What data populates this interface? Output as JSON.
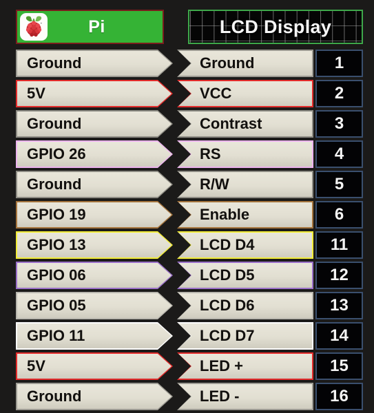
{
  "header": {
    "left": {
      "label": "Pi",
      "icon": "raspberry-pi-logo",
      "bg_color": "#35b335",
      "border_color": "#7a1d1d"
    },
    "right": {
      "label": "LCD Display",
      "bg_color": "#050505",
      "border_color": "#3ea84a"
    }
  },
  "rows": [
    {
      "pi": "Ground",
      "lcd": "Ground",
      "pin": "1",
      "color": "#9c9a92"
    },
    {
      "pi": "5V",
      "lcd": "VCC",
      "pin": "2",
      "color": "#e32b2b"
    },
    {
      "pi": "Ground",
      "lcd": "Contrast",
      "pin": "3",
      "color": "#8d8b83"
    },
    {
      "pi": "GPIO 26",
      "lcd": "RS",
      "pin": "4",
      "color": "#edb3ef"
    },
    {
      "pi": "Ground",
      "lcd": "R/W",
      "pin": "5",
      "color": "#8d8b83"
    },
    {
      "pi": "GPIO 19",
      "lcd": "Enable",
      "pin": "6",
      "color": "#a5743c"
    },
    {
      "pi": "GPIO 13",
      "lcd": "LCD D4",
      "pin": "11",
      "color": "#f2ec36"
    },
    {
      "pi": "GPIO 06",
      "lcd": "LCD D5",
      "pin": "12",
      "color": "#9a6fc9"
    },
    {
      "pi": "GPIO 05",
      "lcd": "LCD D6",
      "pin": "13",
      "color": "#b8b6ae"
    },
    {
      "pi": "GPIO 11",
      "lcd": "LCD D7",
      "pin": "14",
      "color": "#fdfdfd"
    },
    {
      "pi": "5V",
      "lcd": "LED +",
      "pin": "15",
      "color": "#e32b2b"
    },
    {
      "pi": "Ground",
      "lcd": "LED -",
      "pin": "16",
      "color": "#9c9a92"
    }
  ],
  "pin_box": {
    "bg_color": "#030305",
    "border_color": "#3a4f6e",
    "text_color": "#f4f4f4"
  },
  "band": {
    "fill_color": "#e2dfd2",
    "text_color": "#12100e"
  },
  "page": {
    "background_color": "#1b1a19"
  }
}
